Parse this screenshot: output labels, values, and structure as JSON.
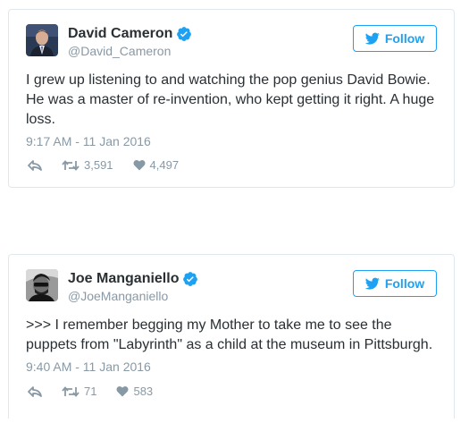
{
  "tweets": [
    {
      "display_name": "David Cameron",
      "handle": "@David_Cameron",
      "follow_label": "Follow",
      "text": "I grew up listening to and watching the pop genius David Bowie. He was a master of re-invention, who kept getting it right. A huge loss.",
      "timestamp": "9:17 AM - 11 Jan 2016",
      "retweets": "3,591",
      "likes": "4,497",
      "verified": true
    },
    {
      "display_name": "Joe Manganiello",
      "handle": "@JoeManganiello",
      "follow_label": "Follow",
      "text": ">>> I remember begging my Mother to take me to see the puppets from \"Labyrinth\" as a child at the museum in Pittsburgh.",
      "timestamp": "9:40 AM - 11 Jan 2016",
      "retweets": "71",
      "likes": "583",
      "verified": true
    }
  ],
  "icons": {
    "verified": "verified-badge-icon",
    "follow": "twitter-bird-icon",
    "reply": "reply-icon",
    "retweet": "retweet-icon",
    "like": "heart-icon"
  },
  "colors": {
    "accent": "#1da1f2",
    "muted": "#8899a6",
    "text": "#292f33",
    "border": "#e1e8ed"
  }
}
